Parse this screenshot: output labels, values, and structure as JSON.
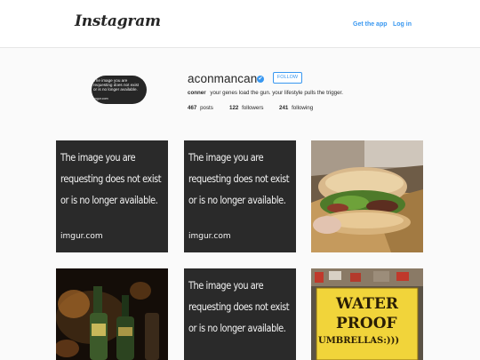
{
  "header": {
    "logo_text": "Instagram",
    "get_app_label": "Get the app",
    "login_label": "Log in"
  },
  "profile": {
    "avatar_text": [
      "The image you are",
      "requesting does not exist",
      "or is no longer available.",
      "imgur.com"
    ],
    "username": "aconmancan",
    "verified_icon": "✔",
    "follow_label": "FOLLOW",
    "full_name": "conner",
    "bio": "your genes load the gun. your lifestyle pulls the trigger.",
    "stats": {
      "posts_count": "467",
      "posts_label": "posts",
      "followers_count": "122",
      "followers_label": "followers",
      "following_count": "241",
      "following_label": "following"
    }
  },
  "placeholder_text": {
    "line1": "The image you are",
    "line2": "requesting does not exist",
    "line3": "or is no longer available.",
    "line4": "imgur.com"
  },
  "sign_text": {
    "line1": "WATER",
    "line2": "PROOF",
    "line3": "UMBRELLAS:)))"
  },
  "colors": {
    "link_blue": "#3897f0",
    "background": "#fafafa",
    "placeholder_bg": "#2a2a2a"
  }
}
